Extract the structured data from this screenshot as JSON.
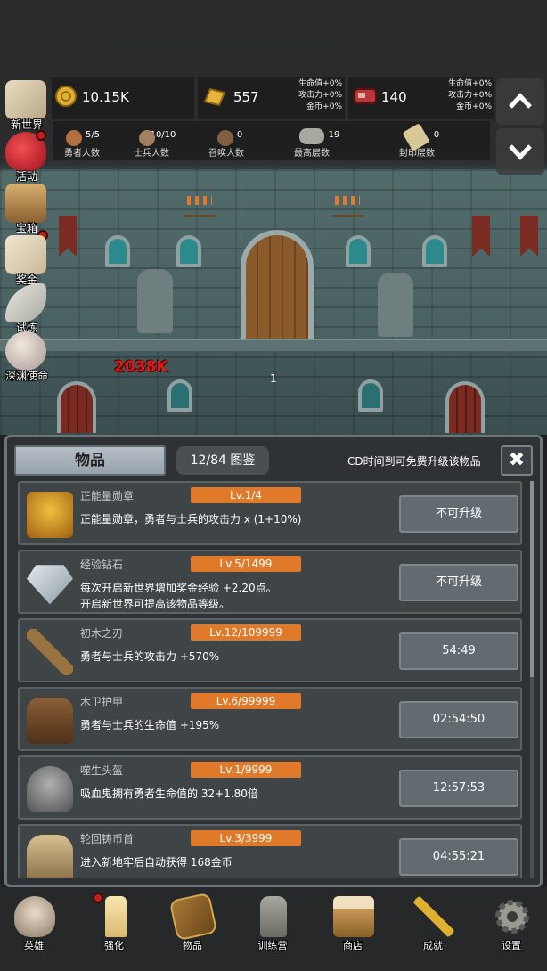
{
  "left_menu": [
    {
      "label": "新世界",
      "icon": "map-icon",
      "dot": false
    },
    {
      "label": "活动",
      "icon": "heart-icon",
      "dot": true
    },
    {
      "label": "宝箱",
      "icon": "treasure-chest-icon",
      "dot": true
    },
    {
      "label": "奖金",
      "icon": "envelope-icon",
      "dot": false
    },
    {
      "label": "试炼",
      "icon": "wing-icon",
      "dot": false
    },
    {
      "label": "深渊使命",
      "icon": "orb-icon",
      "dot": false
    }
  ],
  "resources": {
    "gold": "10.15K",
    "gold_bar": "557",
    "meat": "140",
    "bonus_1": [
      "生命值+0%",
      "攻击力+0%",
      "金币+0%"
    ],
    "bonus_2": [
      "生命值+0%",
      "攻击力+0%",
      "金币+0%"
    ]
  },
  "stats": [
    {
      "value": "5/5",
      "label": "勇者人数"
    },
    {
      "value": "10/10",
      "label": "士兵人数"
    },
    {
      "value": "0",
      "label": "召唤人数"
    },
    {
      "value": "19",
      "label": "最高层数"
    },
    {
      "value": "0",
      "label": "封印层数"
    }
  ],
  "scene": {
    "damage": "2038K",
    "wave": "1"
  },
  "panel": {
    "tab_label": "物品",
    "catalog": "12/84 图鉴",
    "cd_note": "CD时间到可免费升级该物品",
    "close": "✖"
  },
  "items": [
    {
      "name": "正能量勋章",
      "level": "Lv.1/4",
      "desc": "正能量勋章，勇者与士兵的攻击力 x (1+10%)",
      "action": "不可升级",
      "icon": "crown-medal-icon",
      "color": "#d8a020"
    },
    {
      "name": "经验钻石",
      "level": "Lv.5/1499",
      "desc": "每次开启新世界增加奖金经验 +2.20点。\n开启新世界可提高该物品等级。",
      "action": "不可升级",
      "icon": "diamond-icon",
      "color": "#b9c6cf"
    },
    {
      "name": "初木之刃",
      "level": "Lv.12/109999",
      "desc": "勇者与士兵的攻击力 +570%",
      "action": "54:49",
      "icon": "wooden-sword-icon",
      "color": "#8a6a3a"
    },
    {
      "name": "木卫护甲",
      "level": "Lv.6/99999",
      "desc": "勇者与士兵的生命值 +195%",
      "action": "02:54:50",
      "icon": "wooden-armor-icon",
      "color": "#6a4a2a"
    },
    {
      "name": "噬生头盔",
      "level": "Lv.1/9999",
      "desc": "吸血鬼拥有勇者生命值的 32+1.80倍",
      "action": "12:57:53",
      "icon": "helmet-icon",
      "color": "#8a8a8a"
    },
    {
      "name": "轮回铸币首",
      "level": "Lv.3/3999",
      "desc": "进入新地牢后自动获得 168金币",
      "action": "04:55:21",
      "icon": "bucket-helm-icon",
      "color": "#b8a078"
    }
  ],
  "nav": [
    {
      "label": "英雄",
      "icon": "skull-icon",
      "dot": false
    },
    {
      "label": "强化",
      "icon": "candle-icon",
      "dot": true
    },
    {
      "label": "物品",
      "icon": "book-icon",
      "dot": false
    },
    {
      "label": "训练营",
      "icon": "lantern-icon",
      "dot": false
    },
    {
      "label": "商店",
      "icon": "beer-mug-icon",
      "dot": false
    },
    {
      "label": "成就",
      "icon": "key-icon",
      "dot": false
    },
    {
      "label": "设置",
      "icon": "gear-icon",
      "dot": false
    }
  ]
}
